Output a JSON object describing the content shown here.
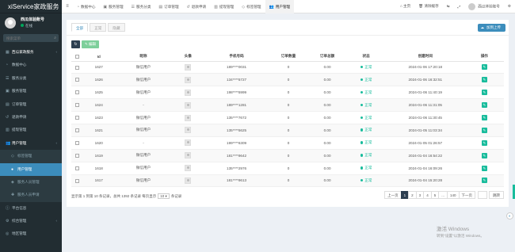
{
  "brand": "xiService家政服务",
  "user": {
    "name": "西瓜体验账号",
    "status": "在线"
  },
  "search": {
    "placeholder": "搜索菜单"
  },
  "menu": [
    {
      "label": "西瓜家政服务",
      "icon": "grid-icon",
      "type": "head",
      "caret": "‹"
    },
    {
      "label": "数据中心",
      "icon": "dashboard-icon",
      "type": "item",
      "caret": ""
    },
    {
      "label": "服务分类",
      "icon": "list-icon",
      "type": "item",
      "caret": ""
    },
    {
      "label": "服务管理",
      "icon": "briefcase-icon",
      "type": "item",
      "caret": ""
    },
    {
      "label": "订单管理",
      "icon": "order-icon",
      "type": "item",
      "caret": ""
    },
    {
      "label": "退款申请",
      "icon": "refund-icon",
      "type": "item",
      "caret": ""
    },
    {
      "label": "提现管理",
      "icon": "wallet-icon",
      "type": "item",
      "caret": ""
    },
    {
      "label": "用户管理",
      "icon": "users-icon",
      "type": "head",
      "caret": "‹"
    },
    {
      "label": "标签管理",
      "icon": "tag-icon",
      "type": "sub",
      "caret": ""
    },
    {
      "label": "用户管理",
      "icon": "user-icon",
      "type": "sub active",
      "caret": ""
    },
    {
      "label": "服务人员管理",
      "icon": "staff-icon",
      "type": "sub",
      "caret": ""
    },
    {
      "label": "服务人员申请",
      "icon": "apply-icon",
      "type": "sub",
      "caret": ""
    },
    {
      "label": "平台信息",
      "icon": "info-icon",
      "type": "item",
      "caret": ""
    },
    {
      "label": "综合管理",
      "icon": "cog-icon",
      "type": "item",
      "caret": "‹"
    },
    {
      "label": "地区管理",
      "icon": "map-icon",
      "type": "item",
      "caret": ""
    }
  ],
  "topnav": [
    {
      "label": "数据中心",
      "icon": "dashboard-icon",
      "active": false
    },
    {
      "label": "服务管理",
      "icon": "briefcase-icon",
      "active": false
    },
    {
      "label": "服务分类",
      "icon": "list-icon",
      "active": false
    },
    {
      "label": "订单管理",
      "icon": "order-icon",
      "active": false
    },
    {
      "label": "退款申请",
      "icon": "refund-icon",
      "active": false
    },
    {
      "label": "提现管理",
      "icon": "wallet-icon",
      "active": false
    },
    {
      "label": "标签管理",
      "icon": "tag-icon",
      "active": false
    },
    {
      "label": "用户管理",
      "icon": "users-icon",
      "active": true
    }
  ],
  "topright": {
    "home": "主页",
    "clear_cache": "清除缓存",
    "username": "西瓜体验账号"
  },
  "filter_tabs": [
    "全部",
    "正常",
    "隐藏"
  ],
  "upload_label": "加到上传",
  "edit_label": "编辑",
  "table": {
    "headers": [
      "",
      "Id",
      "昵称",
      "头像",
      "手机号码",
      "订单数量",
      "订单总额",
      "状态",
      "创建时间",
      "操作"
    ],
    "rows": [
      {
        "id": "1627",
        "nickname": "微信用户",
        "phone": "189****0031",
        "orders": "0",
        "total": "0.00",
        "status": "正常",
        "created": "2024-01-06 17:20:18"
      },
      {
        "id": "1626",
        "nickname": "微信用户",
        "phone": "134****5727",
        "orders": "0",
        "total": "0.00",
        "status": "正常",
        "created": "2024-01-06 16:32:51"
      },
      {
        "id": "1625",
        "nickname": "微信用户",
        "phone": "198****5999",
        "orders": "0",
        "total": "0.00",
        "status": "正常",
        "created": "2024-01-06 11:40:19"
      },
      {
        "id": "1624",
        "nickname": "-",
        "phone": "189****1281",
        "orders": "0",
        "total": "0.00",
        "status": "正常",
        "created": "2024-01-06 11:31:05"
      },
      {
        "id": "1623",
        "nickname": "微信用户",
        "phone": "135****7672",
        "orders": "0",
        "total": "0.00",
        "status": "正常",
        "created": "2024-01-06 11:30:45"
      },
      {
        "id": "1621",
        "nickname": "微信用户",
        "phone": "135****5625",
        "orders": "0",
        "total": "0.00",
        "status": "正常",
        "created": "2024-01-05 11:03:34"
      },
      {
        "id": "1620",
        "nickname": "-",
        "phone": "199****6309",
        "orders": "0",
        "total": "0.00",
        "status": "正常",
        "created": "2024-01-05 01:26:57"
      },
      {
        "id": "1619",
        "nickname": "微信用户",
        "phone": "181****9642",
        "orders": "0",
        "total": "0.00",
        "status": "正常",
        "created": "2024-01-04 16:54:22"
      },
      {
        "id": "1618",
        "nickname": "微信用户",
        "phone": "135****2976",
        "orders": "0",
        "total": "0.00",
        "status": "正常",
        "created": "2024-01-04 16:09:26"
      },
      {
        "id": "1617",
        "nickname": "微信用户",
        "phone": "181****9613",
        "orders": "0",
        "total": "0.00",
        "status": "正常",
        "created": "2024-01-04 15:20:28"
      }
    ]
  },
  "pager": {
    "info_prefix": "显示第 1 到第 10 条记录，总共 1392 条记录 每页显示",
    "page_size": "10",
    "info_suffix": "条记录",
    "prev": "上一页",
    "pages": [
      "1",
      "2",
      "3",
      "4",
      "5",
      "...",
      "140"
    ],
    "active_page": "1",
    "next": "下一页",
    "jump": "跳转"
  },
  "watermark": {
    "title": "激活 Windows",
    "sub": "转到\"设置\"以激活 Windows。"
  },
  "colors": {
    "sidebar": "#222d32",
    "primary": "#3c8dbc",
    "success": "#18bc9c"
  }
}
